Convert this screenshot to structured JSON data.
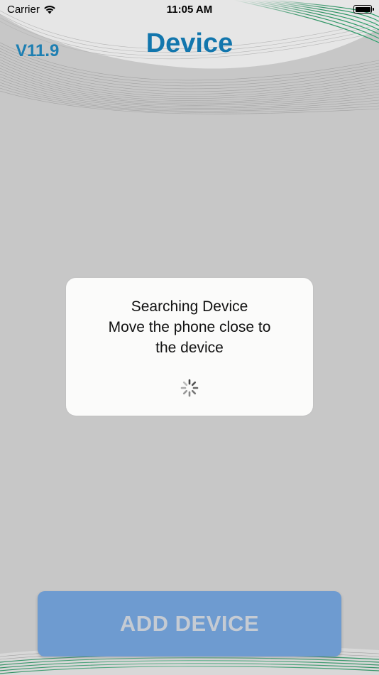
{
  "status_bar": {
    "carrier": "Carrier",
    "time": "11:05 AM",
    "wifi_icon": "wifi-icon",
    "battery_icon": "battery-icon",
    "battery_level": 1.0
  },
  "nav": {
    "version": "V11.9",
    "title": "Device"
  },
  "dialog": {
    "line1": "Searching Device",
    "line2": "Move the phone close to",
    "line3": "the device",
    "spinner_icon": "loading-spinner-icon"
  },
  "add_button": {
    "label": "ADD DEVICE"
  },
  "colors": {
    "background": "#c7c7c7",
    "title_blue": "#1276ad",
    "accent_green": "#2e9a63",
    "button_blue": "#6e9bd0"
  }
}
